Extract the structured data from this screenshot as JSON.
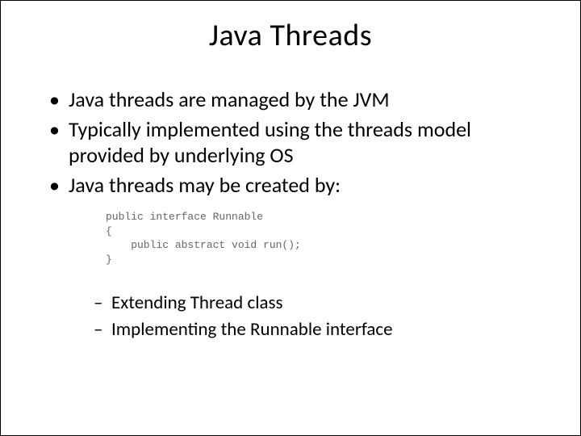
{
  "title": "Java Threads",
  "bullets": {
    "b0": "Java threads are managed by the JVM",
    "b1": "Typically implemented using the threads model provided by underlying OS",
    "b2": "Java threads may be created by:"
  },
  "code": "public interface Runnable\n{\n    public abstract void run();\n}",
  "sub_bullets": {
    "s0": "Extending Thread class",
    "s1": "Implementing the Runnable interface"
  }
}
